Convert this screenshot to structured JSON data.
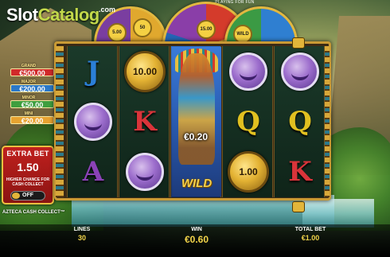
{
  "header": {
    "top_text": "PLAYING FOR FUN",
    "logo_part1": "Slot",
    "logo_part2": "Catalog",
    "logo_suffix": ".com"
  },
  "wheels": {
    "left_chips": [
      "5.00",
      "50"
    ],
    "center_chips": [
      "15.00"
    ],
    "right_chips": [
      "WILD"
    ]
  },
  "jackpots": [
    {
      "label": "GRAND",
      "value": "€500.00",
      "color": "#d12a2a"
    },
    {
      "label": "MAJOR",
      "value": "€200.00",
      "color": "#2a78c9"
    },
    {
      "label": "MINOR",
      "value": "€50.00",
      "color": "#3f9f3f"
    },
    {
      "label": "MINI",
      "value": "€20.00",
      "color": "#e7a230"
    }
  ],
  "extra_bet": {
    "title": "EXTRA BET",
    "value": "1.50",
    "description": "HIGHER CHANCE FOR CASH COLLECT",
    "toggle_state": "OFF"
  },
  "game_name": "AZTECA CASH COLLECT™",
  "reels": [
    [
      {
        "type": "letter",
        "text": "J"
      },
      {
        "type": "purple-coin"
      },
      {
        "type": "letter",
        "text": "A"
      }
    ],
    [
      {
        "type": "gold-coin",
        "text": "10.00"
      },
      {
        "type": "letter",
        "text": "K"
      },
      {
        "type": "purple-coin"
      }
    ],
    [
      {
        "type": "wild",
        "text": "WILD"
      }
    ],
    [
      {
        "type": "purple-coin"
      },
      {
        "type": "letter",
        "text": "Q"
      },
      {
        "type": "gold-coin",
        "text": "1.00"
      }
    ],
    [
      {
        "type": "purple-coin"
      },
      {
        "type": "letter",
        "text": "Q"
      },
      {
        "type": "letter",
        "text": "K"
      }
    ]
  ],
  "win_overlay": "€0.20",
  "bottom_bar": {
    "lines_label": "LINES",
    "lines_value": "30",
    "win_label": "WIN",
    "win_value": "€0.60",
    "total_bet_label": "TOTAL BET",
    "total_bet_value": "€1.00"
  }
}
